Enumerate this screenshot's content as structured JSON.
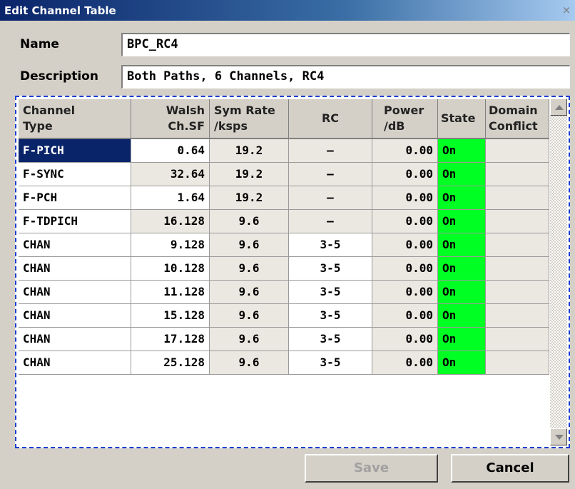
{
  "window": {
    "title": "Edit Channel Table",
    "close_glyph": "×"
  },
  "form": {
    "name_label": "Name",
    "name_value": "BPC_RC4",
    "description_label": "Description",
    "description_value": "Both Paths, 6 Channels, RC4"
  },
  "table": {
    "headers": [
      {
        "line1": "Channel",
        "line2": "Type"
      },
      {
        "line1": "Walsh",
        "line2": "Ch.SF"
      },
      {
        "line1": "Sym Rate",
        "line2": "/ksps"
      },
      {
        "line1": "RC",
        "line2": ""
      },
      {
        "line1": "Power",
        "line2": "/dB"
      },
      {
        "line1": "State",
        "line2": ""
      },
      {
        "line1": "Domain",
        "line2": "Conflict"
      }
    ],
    "rows": [
      [
        "F-PICH",
        "0.64",
        "19.2",
        "–",
        "0.00",
        "On",
        ""
      ],
      [
        "F-SYNC",
        "32.64",
        "19.2",
        "–",
        "0.00",
        "On",
        ""
      ],
      [
        "F-PCH",
        "1.64",
        "19.2",
        "–",
        "0.00",
        "On",
        ""
      ],
      [
        "F-TDPICH",
        "16.128",
        "9.6",
        "–",
        "0.00",
        "On",
        ""
      ],
      [
        "CHAN",
        "9.128",
        "9.6",
        "3-5",
        "0.00",
        "On",
        ""
      ],
      [
        "CHAN",
        "10.128",
        "9.6",
        "3-5",
        "0.00",
        "On",
        ""
      ],
      [
        "CHAN",
        "11.128",
        "9.6",
        "3-5",
        "0.00",
        "On",
        ""
      ],
      [
        "CHAN",
        "15.128",
        "9.6",
        "3-5",
        "0.00",
        "On",
        ""
      ],
      [
        "CHAN",
        "17.128",
        "9.6",
        "3-5",
        "0.00",
        "On",
        ""
      ],
      [
        "CHAN",
        "25.128",
        "9.6",
        "3-5",
        "0.00",
        "On",
        ""
      ]
    ],
    "selected_row": 0
  },
  "buttons": {
    "save": "Save",
    "cancel": "Cancel"
  },
  "colors": {
    "state_on": "#00ff22",
    "selection": "#0a246a",
    "focus_border": "#1a3fd1"
  },
  "icons": {
    "scroll_up": "scroll-up-arrow-icon",
    "scroll_down": "scroll-down-arrow-icon",
    "close": "close-icon"
  }
}
